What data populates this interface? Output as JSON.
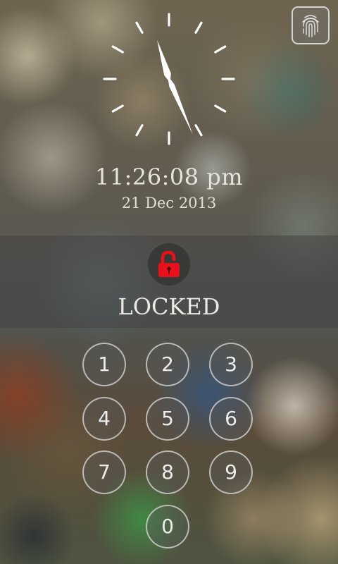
{
  "clock": {
    "hours": 11,
    "minutes": 26,
    "seconds": 8,
    "hand_color": "#ffffff"
  },
  "time_text": "11:26:08 pm",
  "date_text": "21 Dec 2013",
  "fingerprint_button": {
    "icon": "fingerprint-icon"
  },
  "lock": {
    "icon": "padlock-icon",
    "status_text": "LOCKED",
    "icon_color": "#e8101a"
  },
  "keypad": {
    "keys": [
      "1",
      "2",
      "3",
      "4",
      "5",
      "6",
      "7",
      "8",
      "9",
      "0"
    ]
  }
}
